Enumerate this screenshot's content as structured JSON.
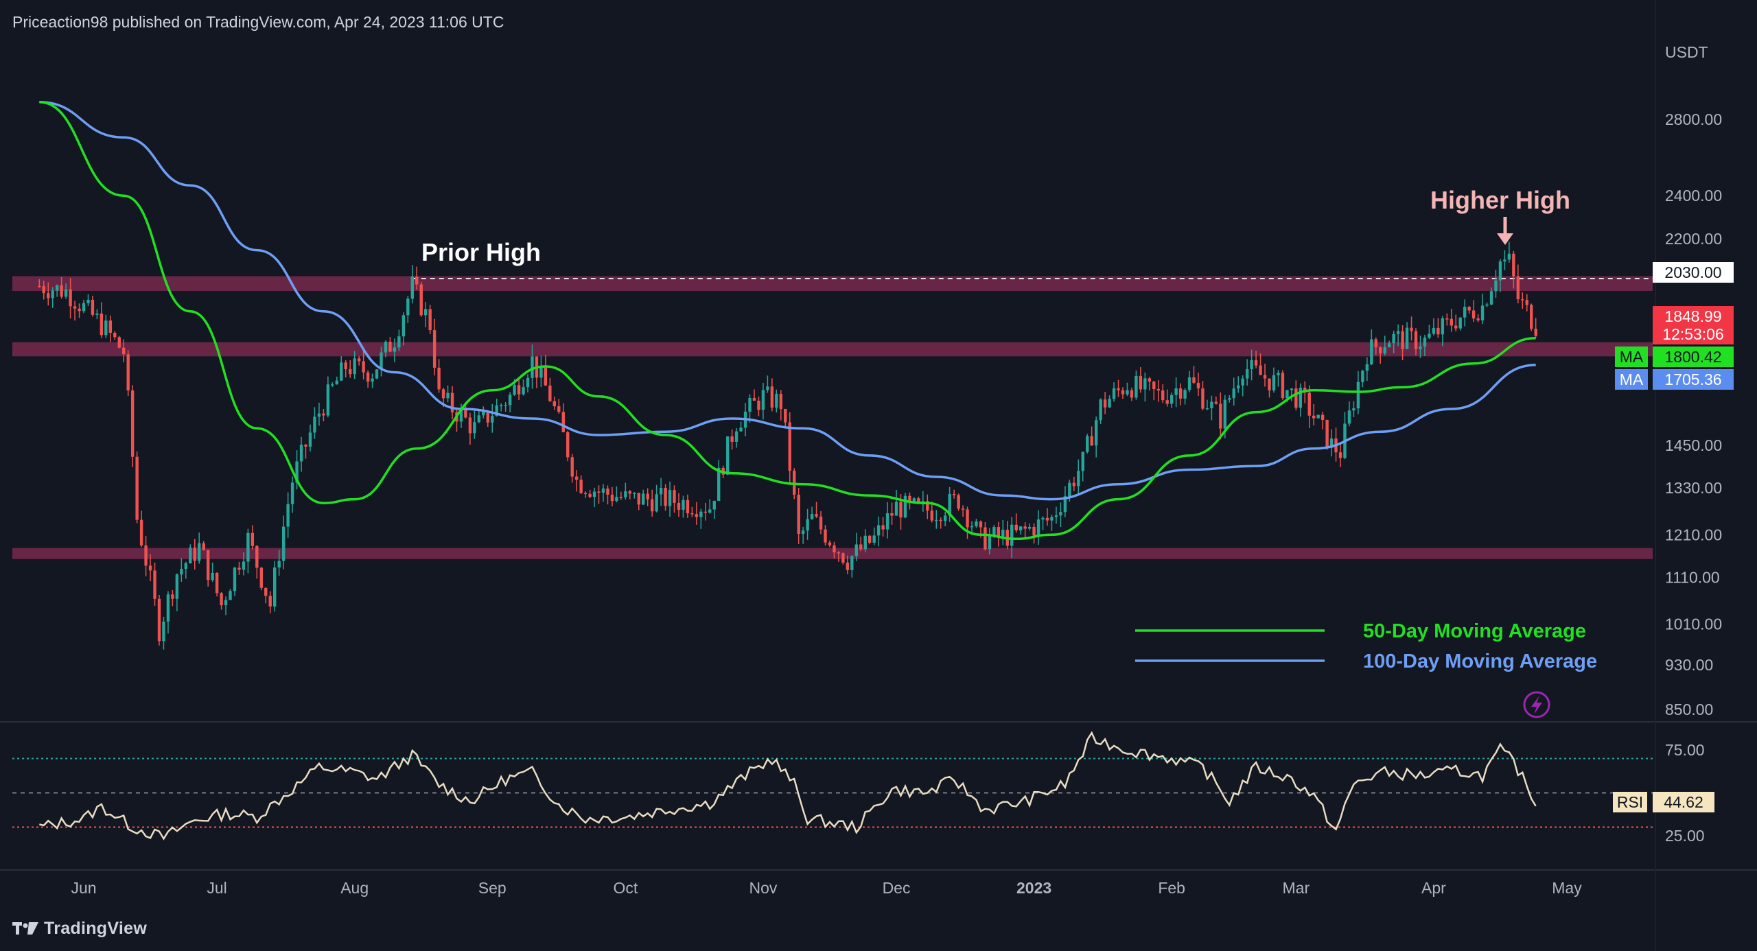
{
  "header": {
    "publish_line": "Priceaction98 published on TradingView.com, Apr 24, 2023 11:06 UTC"
  },
  "footer": {
    "brand": "TradingView"
  },
  "colors": {
    "background": "#131722",
    "candle_up": "#26a69a",
    "candle_down": "#ef5350",
    "ma50": "#21e021",
    "ma100": "#6f9ff5",
    "zone": "#7a2a4e",
    "rsi_line": "#e8dcc2",
    "rsi_upper_line": "#26a69a",
    "rsi_lower_line": "#ef5350",
    "annotation_prior_high": "#ffffff",
    "annotation_higher_high": "#f5b5b5"
  },
  "chart_data": [
    {
      "type": "candlestick",
      "title": "",
      "currency": "USDT",
      "scale": "log",
      "y_ticks": [
        "2800.00",
        "2400.00",
        "2200.00",
        "1450.00",
        "1330.00",
        "1210.00",
        "1110.00",
        "1010.00",
        "930.00",
        "850.00"
      ],
      "x_ticks": [
        "Jun",
        "Jul",
        "Aug",
        "Sep",
        "Oct",
        "Nov",
        "Dec",
        "2023",
        "Feb",
        "Mar",
        "Apr",
        "May"
      ],
      "price_labels": {
        "level": "2030.00",
        "last": "1848.99",
        "countdown": "12:53:06",
        "ma50_tag": "MA",
        "ma50_value": "1800.42",
        "ma100_tag": "MA",
        "ma100_value": "1705.36"
      },
      "zones": [
        {
          "low": 1980,
          "high": 2040
        },
        {
          "low": 1735,
          "high": 1785
        },
        {
          "low": 1152,
          "high": 1178
        }
      ],
      "annotations": {
        "prior_high": "Prior High",
        "higher_high": "Higher High"
      },
      "legend": {
        "ma50": "50-Day Moving Average",
        "ma100": "100-Day Moving Average"
      },
      "price_path": [
        [
          "2022-05-22",
          2000
        ],
        [
          "2022-05-28",
          1980
        ],
        [
          "2022-06-05",
          1850
        ],
        [
          "2022-06-10",
          1750
        ],
        [
          "2022-06-13",
          1250
        ],
        [
          "2022-06-18",
          1000
        ],
        [
          "2022-06-22",
          1120
        ],
        [
          "2022-06-27",
          1180
        ],
        [
          "2022-07-02",
          1050
        ],
        [
          "2022-07-08",
          1200
        ],
        [
          "2022-07-13",
          1050
        ],
        [
          "2022-07-18",
          1350
        ],
        [
          "2022-07-24",
          1550
        ],
        [
          "2022-07-30",
          1700
        ],
        [
          "2022-08-05",
          1680
        ],
        [
          "2022-08-10",
          1800
        ],
        [
          "2022-08-14",
          2000
        ],
        [
          "2022-08-18",
          1850
        ],
        [
          "2022-08-20",
          1600
        ],
        [
          "2022-08-28",
          1500
        ],
        [
          "2022-09-05",
          1600
        ],
        [
          "2022-09-10",
          1720
        ],
        [
          "2022-09-14",
          1600
        ],
        [
          "2022-09-20",
          1350
        ],
        [
          "2022-09-25",
          1320
        ],
        [
          "2022-10-02",
          1300
        ],
        [
          "2022-10-10",
          1300
        ],
        [
          "2022-10-20",
          1280
        ],
        [
          "2022-10-26",
          1520
        ],
        [
          "2022-11-01",
          1600
        ],
        [
          "2022-11-05",
          1580
        ],
        [
          "2022-11-09",
          1200
        ],
        [
          "2022-11-12",
          1250
        ],
        [
          "2022-11-20",
          1150
        ],
        [
          "2022-11-26",
          1200
        ],
        [
          "2022-12-01",
          1280
        ],
        [
          "2022-12-10",
          1270
        ],
        [
          "2022-12-15",
          1300
        ],
        [
          "2022-12-20",
          1200
        ],
        [
          "2022-12-28",
          1210
        ],
        [
          "2023-01-05",
          1250
        ],
        [
          "2023-01-12",
          1400
        ],
        [
          "2023-01-16",
          1570
        ],
        [
          "2023-01-22",
          1640
        ],
        [
          "2023-01-30",
          1600
        ],
        [
          "2023-02-05",
          1650
        ],
        [
          "2023-02-12",
          1530
        ],
        [
          "2023-02-17",
          1700
        ],
        [
          "2023-02-25",
          1640
        ],
        [
          "2023-03-03",
          1580
        ],
        [
          "2023-03-09",
          1450
        ],
        [
          "2023-03-11",
          1430
        ],
        [
          "2023-03-17",
          1750
        ],
        [
          "2023-03-22",
          1800
        ],
        [
          "2023-03-30",
          1790
        ],
        [
          "2023-04-06",
          1870
        ],
        [
          "2023-04-12",
          1920
        ],
        [
          "2023-04-16",
          2100
        ],
        [
          "2023-04-18",
          2100
        ],
        [
          "2023-04-20",
          1950
        ],
        [
          "2023-04-24",
          1849
        ]
      ],
      "ma50_path": [
        [
          "2022-05-22",
          2900
        ],
        [
          "2022-06-10",
          2400
        ],
        [
          "2022-06-25",
          1900
        ],
        [
          "2022-07-10",
          1500
        ],
        [
          "2022-07-25",
          1290
        ],
        [
          "2022-08-01",
          1300
        ],
        [
          "2022-08-15",
          1440
        ],
        [
          "2022-09-01",
          1620
        ],
        [
          "2022-09-13",
          1700
        ],
        [
          "2022-09-25",
          1600
        ],
        [
          "2022-10-10",
          1480
        ],
        [
          "2022-10-25",
          1370
        ],
        [
          "2022-11-10",
          1340
        ],
        [
          "2022-11-25",
          1310
        ],
        [
          "2022-12-08",
          1290
        ],
        [
          "2022-12-20",
          1210
        ],
        [
          "2022-12-28",
          1200
        ],
        [
          "2023-01-05",
          1210
        ],
        [
          "2023-01-20",
          1300
        ],
        [
          "2023-02-05",
          1420
        ],
        [
          "2023-02-20",
          1550
        ],
        [
          "2023-03-05",
          1620
        ],
        [
          "2023-03-15",
          1615
        ],
        [
          "2023-03-25",
          1630
        ],
        [
          "2023-04-10",
          1710
        ],
        [
          "2023-04-24",
          1800
        ]
      ],
      "ma100_path": [
        [
          "2022-05-22",
          2900
        ],
        [
          "2022-06-10",
          2700
        ],
        [
          "2022-06-25",
          2450
        ],
        [
          "2022-07-10",
          2150
        ],
        [
          "2022-07-25",
          1900
        ],
        [
          "2022-08-10",
          1680
        ],
        [
          "2022-08-25",
          1560
        ],
        [
          "2022-09-10",
          1530
        ],
        [
          "2022-09-25",
          1480
        ],
        [
          "2022-10-10",
          1490
        ],
        [
          "2022-10-25",
          1530
        ],
        [
          "2022-11-10",
          1500
        ],
        [
          "2022-11-25",
          1420
        ],
        [
          "2022-12-10",
          1360
        ],
        [
          "2022-12-25",
          1310
        ],
        [
          "2023-01-05",
          1300
        ],
        [
          "2023-01-20",
          1340
        ],
        [
          "2023-02-05",
          1380
        ],
        [
          "2023-02-20",
          1390
        ],
        [
          "2023-03-05",
          1440
        ],
        [
          "2023-03-20",
          1490
        ],
        [
          "2023-04-05",
          1560
        ],
        [
          "2023-04-24",
          1705
        ]
      ]
    },
    {
      "type": "line",
      "title": "",
      "indicator": "RSI",
      "value_label": "44.62",
      "y_ticks": [
        "75.00",
        "25.00"
      ],
      "levels": [
        70,
        50,
        30
      ],
      "ylim": [
        15,
        85
      ],
      "rsi_path": [
        [
          "2022-05-22",
          30
        ],
        [
          "2022-06-01",
          35
        ],
        [
          "2022-06-05",
          42
        ],
        [
          "2022-06-12",
          30
        ],
        [
          "2022-06-19",
          24
        ],
        [
          "2022-06-26",
          34
        ],
        [
          "2022-07-03",
          38
        ],
        [
          "2022-07-10",
          36
        ],
        [
          "2022-07-17",
          50
        ],
        [
          "2022-07-24",
          65
        ],
        [
          "2022-08-01",
          62
        ],
        [
          "2022-08-06",
          58
        ],
        [
          "2022-08-14",
          72
        ],
        [
          "2022-08-20",
          55
        ],
        [
          "2022-08-27",
          45
        ],
        [
          "2022-09-04",
          58
        ],
        [
          "2022-09-10",
          62
        ],
        [
          "2022-09-16",
          43
        ],
        [
          "2022-09-22",
          35
        ],
        [
          "2022-10-01",
          36
        ],
        [
          "2022-10-10",
          40
        ],
        [
          "2022-10-20",
          44
        ],
        [
          "2022-10-28",
          60
        ],
        [
          "2022-11-03",
          70
        ],
        [
          "2022-11-08",
          55
        ],
        [
          "2022-11-11",
          35
        ],
        [
          "2022-11-22",
          30
        ],
        [
          "2022-11-30",
          52
        ],
        [
          "2022-12-08",
          50
        ],
        [
          "2022-12-14",
          58
        ],
        [
          "2022-12-21",
          40
        ],
        [
          "2022-12-30",
          45
        ],
        [
          "2023-01-08",
          55
        ],
        [
          "2023-01-14",
          82
        ],
        [
          "2023-01-22",
          75
        ],
        [
          "2023-02-01",
          70
        ],
        [
          "2023-02-08",
          65
        ],
        [
          "2023-02-14",
          45
        ],
        [
          "2023-02-20",
          65
        ],
        [
          "2023-02-28",
          58
        ],
        [
          "2023-03-05",
          48
        ],
        [
          "2023-03-10",
          28
        ],
        [
          "2023-03-14",
          55
        ],
        [
          "2023-03-20",
          62
        ],
        [
          "2023-03-30",
          60
        ],
        [
          "2023-04-06",
          63
        ],
        [
          "2023-04-12",
          60
        ],
        [
          "2023-04-16",
          75
        ],
        [
          "2023-04-19",
          68
        ],
        [
          "2023-04-24",
          44.6
        ]
      ]
    }
  ]
}
